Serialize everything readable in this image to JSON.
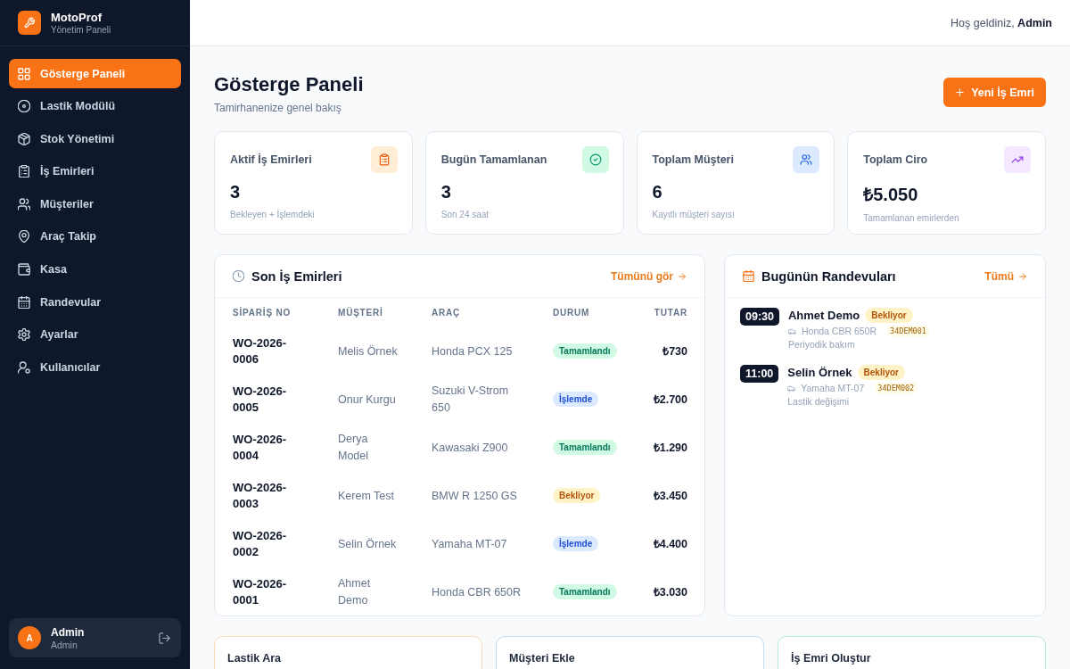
{
  "sidebar": {
    "brand": {
      "title": "MotoProf",
      "subtitle": "Yönetim Paneli"
    },
    "items": [
      {
        "label": "Gösterge Paneli",
        "selected": true
      },
      {
        "label": "Lastik Modülü",
        "selected": false
      },
      {
        "label": "Stok Yönetimi",
        "selected": false
      },
      {
        "label": "İş Emirleri",
        "selected": false
      },
      {
        "label": "Müşteriler",
        "selected": false
      },
      {
        "label": "Araç Takip",
        "selected": false
      },
      {
        "label": "Kasa",
        "selected": false
      },
      {
        "label": "Randevular",
        "selected": false
      },
      {
        "label": "Ayarlar",
        "selected": false
      },
      {
        "label": "Kullanıcılar",
        "selected": false
      }
    ],
    "user": {
      "initial": "A",
      "name": "Admin",
      "role": "Admin"
    }
  },
  "header": {
    "greeting": "Hoş geldiniz, **Admin**"
  },
  "page": {
    "title": "Gösterge Paneli",
    "subtitle": "Tamirhanenize genel bakış",
    "new_button": "Yeni İş Emri"
  },
  "stats": [
    {
      "label": "Aktif İş Emirleri",
      "value": "3",
      "note": "Bekleyen + İşlemdeki"
    },
    {
      "label": "Bugün Tamamlanan",
      "value": "3",
      "note": "Son 24 saat"
    },
    {
      "label": "Toplam Müşteri",
      "value": "6",
      "note": "Kayıtlı müşteri sayısı"
    },
    {
      "label": "Toplam Ciro",
      "value": "₺5.050",
      "note": "Tamamlanan emirlerden"
    }
  ],
  "orders": {
    "title": "Son İş Emirleri",
    "link": "Tümünü gör",
    "columns": [
      "SİPARİŞ NO",
      "MÜŞTERİ",
      "ARAÇ",
      "DURUM",
      "TUTAR"
    ],
    "rows": [
      {
        "order_no": "WO-2026-0006",
        "customer": "Melis Örnek",
        "vehicle": "Honda PCX 125",
        "status": {
          "label": "Tamamlandı",
          "kind": "completed"
        },
        "amount": "₺730"
      },
      {
        "order_no": "WO-2026-0005",
        "customer": "Onur Kurgu",
        "vehicle": "Suzuki V-Strom 650",
        "status": {
          "label": "İşlemde",
          "kind": "in_progress"
        },
        "amount": "₺2.700"
      },
      {
        "order_no": "WO-2026-0004",
        "customer": "Derya Model",
        "vehicle": "Kawasaki Z900",
        "status": {
          "label": "Tamamlandı",
          "kind": "completed"
        },
        "amount": "₺1.290"
      },
      {
        "order_no": "WO-2026-0003",
        "customer": "Kerem Test",
        "vehicle": "BMW R 1250 GS",
        "status": {
          "label": "Bekliyor",
          "kind": "pending"
        },
        "amount": "₺3.450"
      },
      {
        "order_no": "WO-2026-0002",
        "customer": "Selin Örnek",
        "vehicle": "Yamaha MT-07",
        "status": {
          "label": "İşlemde",
          "kind": "in_progress"
        },
        "amount": "₺4.400"
      },
      {
        "order_no": "WO-2026-0001",
        "customer": "Ahmet Demo",
        "vehicle": "Honda CBR 650R",
        "status": {
          "label": "Tamamlandı",
          "kind": "completed"
        },
        "amount": "₺3.030"
      }
    ]
  },
  "appointments": {
    "title": "Bugünün Randevuları",
    "link": "Tümü",
    "items": [
      {
        "time": "09:30",
        "name": "Ahmet Demo",
        "status": {
          "label": "Bekliyor",
          "kind": "pending"
        },
        "vehicle": "Honda CBR 650R",
        "plate": "34DEM001",
        "service": "Periyodik bakım"
      },
      {
        "time": "11:00",
        "name": "Selin Örnek",
        "status": {
          "label": "Bekliyor",
          "kind": "pending"
        },
        "vehicle": "Yamaha MT-07",
        "plate": "34DEM002",
        "service": "Lastik değişimi"
      }
    ]
  },
  "quick_actions": [
    {
      "title": "Lastik Ara",
      "color": "#fcd9b0"
    },
    {
      "title": "Müşteri Ekle",
      "color": "#c3d9f5"
    },
    {
      "title": "İş Emri Oluştur",
      "color": "#b5ecd6"
    }
  ]
}
